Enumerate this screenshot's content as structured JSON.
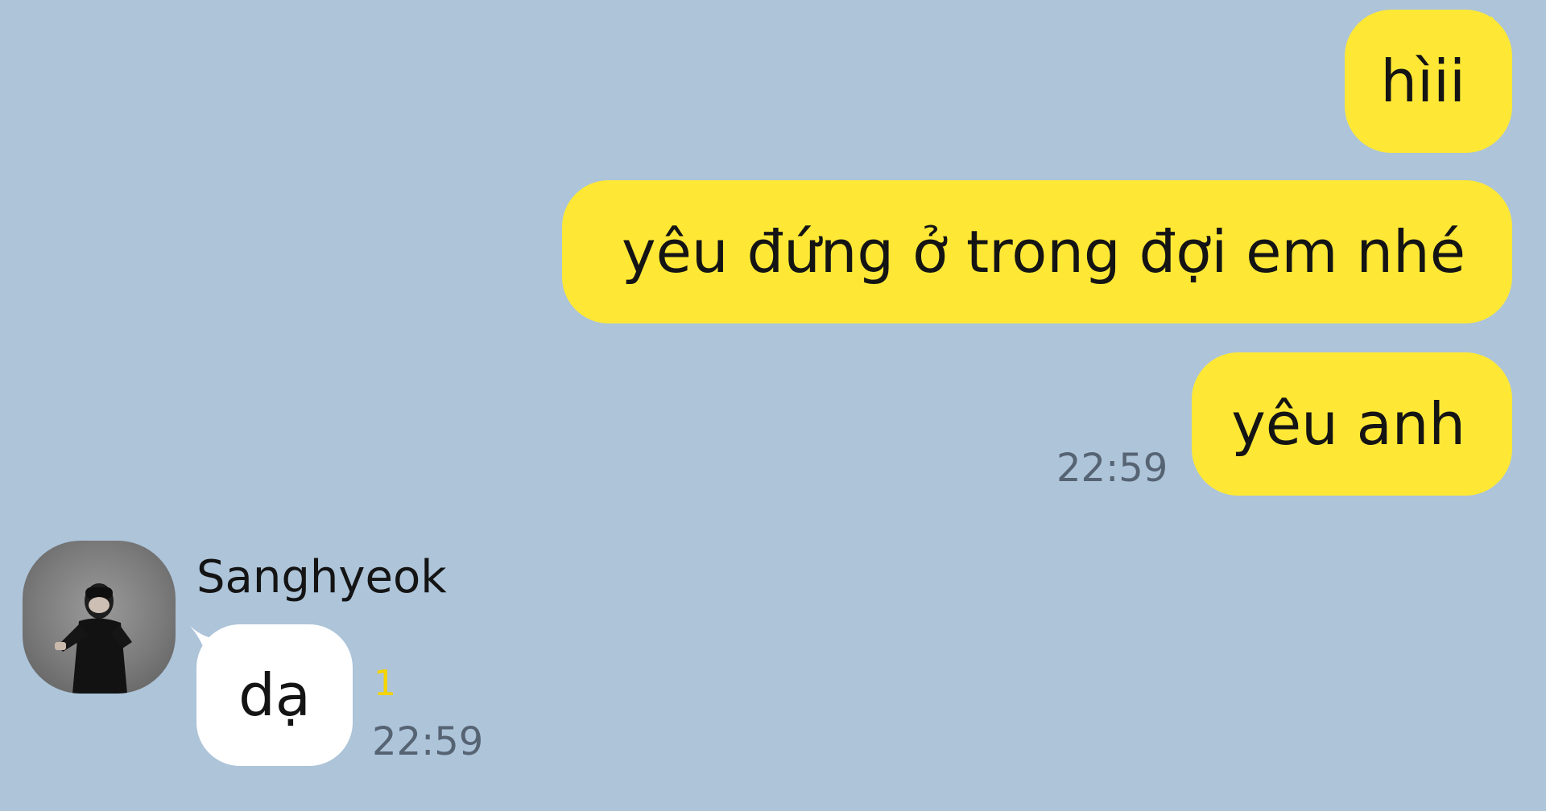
{
  "colors": {
    "background": "#adc4d9",
    "outgoing_bubble": "#fee835",
    "incoming_bubble": "#ffffff",
    "timestamp": "#566373",
    "unread_count": "#f5d400"
  },
  "outgoing_messages": [
    {
      "text": "hìii"
    },
    {
      "text": "yêu đứng ở trong đợi em nhé"
    },
    {
      "text": "yêu anh",
      "time": "22:59"
    }
  ],
  "incoming": {
    "sender": "Sanghyeok",
    "avatar_icon": "profile-photo",
    "message": {
      "text": "dạ",
      "unread": "1",
      "time": "22:59"
    }
  }
}
